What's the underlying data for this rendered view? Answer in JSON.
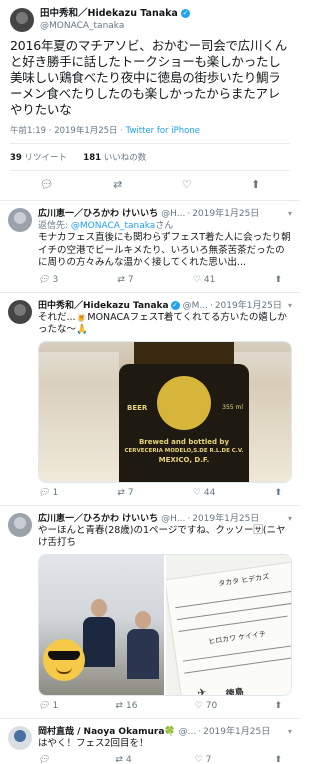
{
  "main_tweet": {
    "display_name": "田中秀和／Hidekazu Tanaka",
    "handle": "@MONACA_tanaka",
    "text": "2016年夏のマチアソビ、おかむー司会で広川くんと好き勝手に話したトークショーも楽しかったし美味しい鶏食べたり夜中に徳島の街歩いたり鯛ラーメン食べたりしたのも楽しかったからまたアレやりたいな",
    "time": "午前1:19 · 2019年1月25日",
    "source": "Twitter for iPhone",
    "retweets_count": "39",
    "retweets_label": "リツイート",
    "likes_count": "181",
    "likes_label": "いいねの数"
  },
  "replies": [
    {
      "display_name": "広川恵一／ひろかわ けいいち",
      "handle": "@H...",
      "date": "2019年1月25日",
      "reply_to_label": "返信先:",
      "reply_to_handle": "@MONACA_tanaka",
      "reply_to_suffix": "さん",
      "text": "モナカフェス直後にも関わらずフェスT着た人に会ったり朝イチの空港でビールキメたり、いろいろ無茶苦茶だったのに周りの方々みんな温かく接してくれた思い出...",
      "replies": "3",
      "retweets": "7",
      "likes": "41"
    },
    {
      "display_name": "田中秀和／Hidekazu Tanaka",
      "handle": "@M...",
      "date": "2019年1月25日",
      "text": "それだ...🍺MONACAフェスT着てくれてる方いたの嬉しかったな〜🙏",
      "media_bottle_top": "BEER",
      "media_bottle_line1": "Brewed and bottled by",
      "media_bottle_line2": "CERVECERIA MODELO,S.DE R.L.DE C.V.",
      "media_bottle_line3": "MEXICO, D.F.",
      "media_bottle_side": "355 ml",
      "replies": "1",
      "retweets": "7",
      "likes": "44"
    },
    {
      "display_name": "広川恵一／ひろかわ けいいち",
      "handle": "@H...",
      "date": "2019年1月25日",
      "text": "やーほんと青春(28歳)の1ページですね、クッソー🈂(ニヤけ舌打ち",
      "paper_name_label": "タカタ ヒデカズ",
      "paper_name_label2": "ヒロカワ ケイイチ",
      "paper_city": "徳島",
      "replies": "1",
      "retweets": "16",
      "likes": "70"
    },
    {
      "display_name": "岡村直哉 / Naoya Okamura🍀",
      "handle": "@...",
      "date": "2019年1月25日",
      "text": "はやく！フェス2回目を！",
      "replies": "",
      "retweets": "4",
      "likes": "7"
    }
  ],
  "icons": {
    "reply": "reply-icon",
    "retweet": "retweet-icon",
    "like": "heart-icon",
    "share": "share-icon",
    "verified": "verified-badge-icon",
    "more": "chevron-down-icon"
  },
  "colors": {
    "accent": "#1da1f2",
    "muted": "#657786",
    "border": "#e6ecf0"
  }
}
